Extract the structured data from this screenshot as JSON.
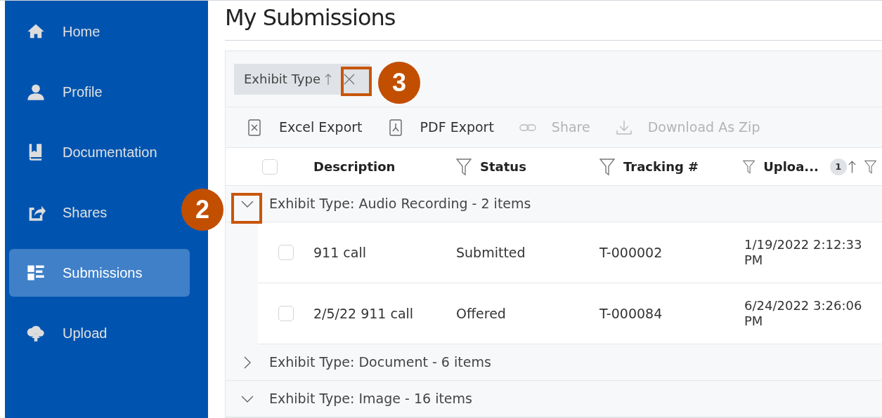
{
  "sidebar": {
    "items": [
      {
        "label": "Home",
        "selected": false
      },
      {
        "label": "Profile",
        "selected": false
      },
      {
        "label": "Documentation",
        "selected": false
      },
      {
        "label": "Shares",
        "selected": false
      },
      {
        "label": "Submissions",
        "selected": true
      },
      {
        "label": "Upload",
        "selected": false
      }
    ]
  },
  "page_title": "My Submissions",
  "group_chip": {
    "label": "Exhibit Type"
  },
  "toolbar": [
    {
      "label": "Excel Export",
      "disabled": false
    },
    {
      "label": "PDF Export",
      "disabled": false
    },
    {
      "label": "Share",
      "disabled": true
    },
    {
      "label": "Download As Zip",
      "disabled": true
    }
  ],
  "table": {
    "select_all": {
      "checked": false
    },
    "columns": [
      {
        "label": "Description"
      },
      {
        "label": "Status"
      },
      {
        "label": "Tracking #"
      },
      {
        "label": "Uploa...",
        "sort_order": "1"
      }
    ],
    "groups": [
      {
        "label": "Exhibit Type: Audio Recording - 2 items",
        "expanded": true,
        "rows": [
          {
            "checked": false,
            "cells": [
              "911 call",
              "Submitted",
              "T-000002",
              "1/19/2022 2:12:33 PM"
            ]
          },
          {
            "checked": false,
            "cells": [
              "2/5/22 911 call",
              "Offered",
              "T-000084",
              "6/24/2022 3:26:06 PM"
            ]
          }
        ]
      },
      {
        "label": "Exhibit Type: Document - 6 items",
        "expanded": false
      },
      {
        "label": "Exhibit Type: Image - 16 items",
        "expanded": true
      }
    ]
  },
  "annotations": [
    {
      "number": "2"
    },
    {
      "number": "3"
    }
  ]
}
